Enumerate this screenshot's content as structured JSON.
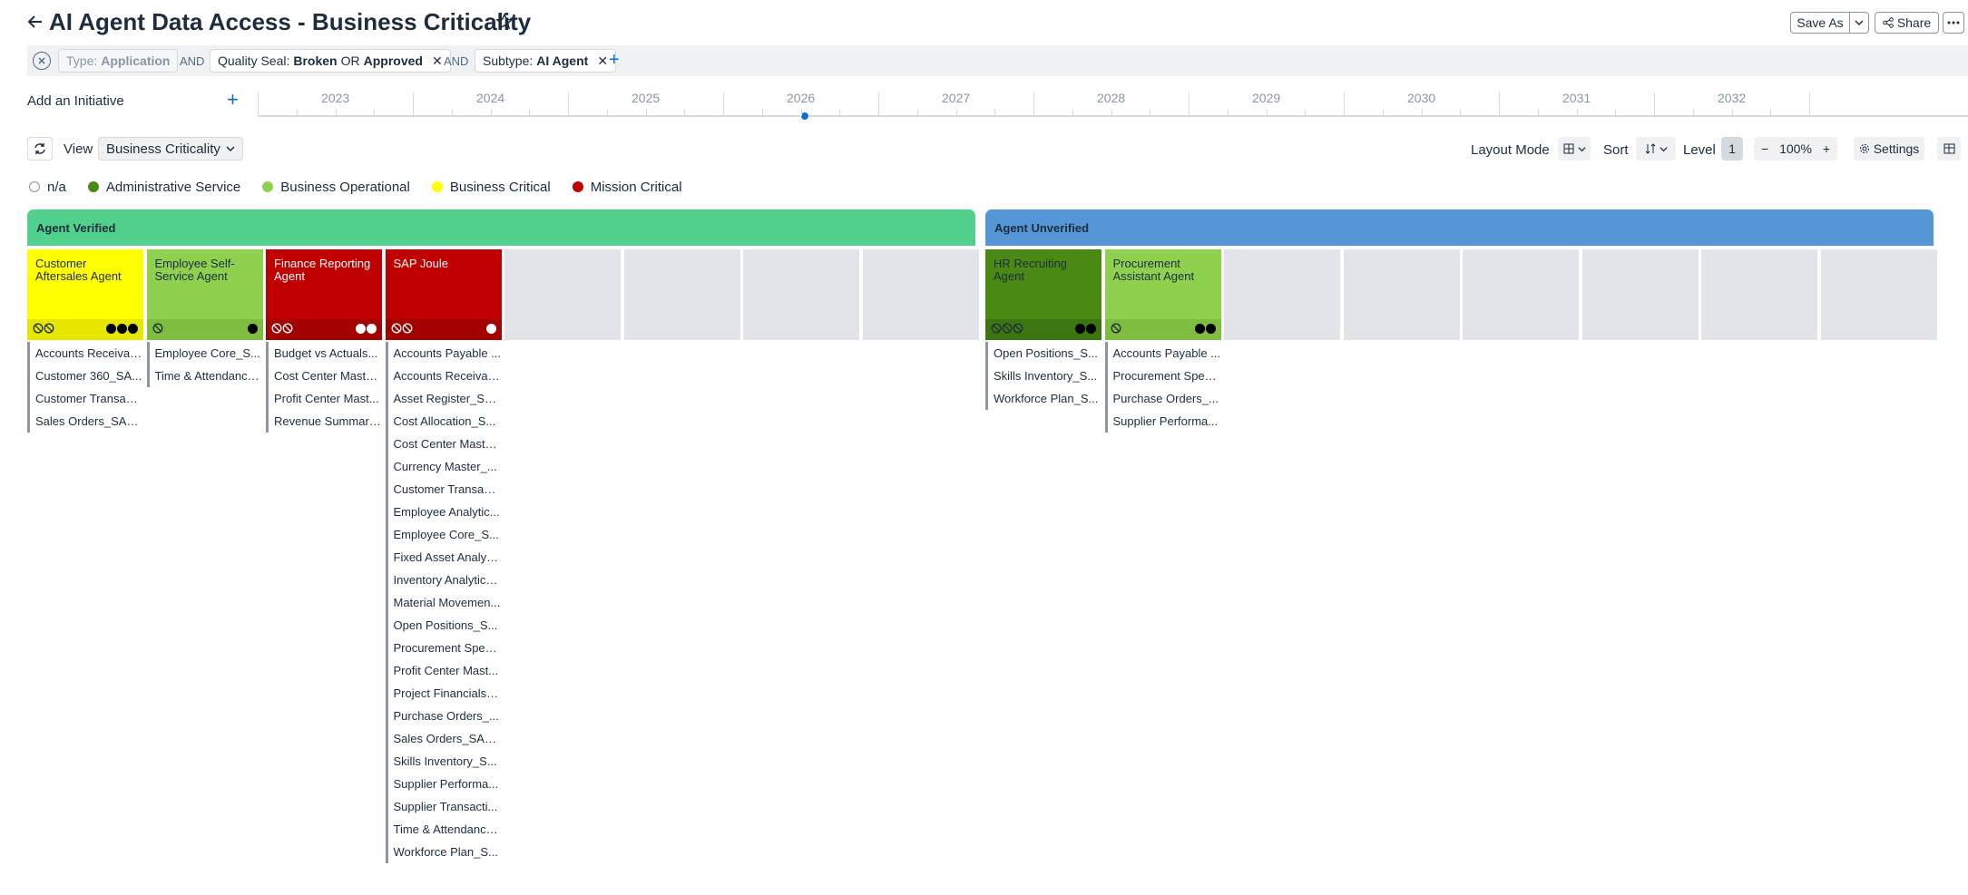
{
  "header": {
    "title": "AI Agent Data Access - Business Criticality",
    "save_as_label": "Save As",
    "share_label": "Share"
  },
  "filters": {
    "chip1": {
      "key": "Type:",
      "value": "Application"
    },
    "op1": "AND",
    "chip2": {
      "key": "Quality Seal:",
      "value_a": "Broken",
      "or": "OR",
      "value_b": "Approved"
    },
    "op2": "AND",
    "chip3": {
      "key": "Subtype:",
      "value": "AI Agent"
    }
  },
  "timeline": {
    "add_initiative_label": "Add an Initiative",
    "years": [
      "2023",
      "2024",
      "2025",
      "2026",
      "2027",
      "2028",
      "2029",
      "2030",
      "2031",
      "2032"
    ],
    "current_year": "2026"
  },
  "toolbar": {
    "view_label": "View",
    "view_value": "Business Criticality",
    "layout_mode_label": "Layout Mode",
    "sort_label": "Sort",
    "level_label": "Level",
    "level_value": "1",
    "zoom_value": "100%",
    "settings_label": "Settings"
  },
  "legend": [
    {
      "label": "n/a",
      "color": "#ffffff"
    },
    {
      "label": "Administrative Service",
      "color": "#4a8a14"
    },
    {
      "label": "Business Operational",
      "color": "#8fd14f"
    },
    {
      "label": "Business Critical",
      "color": "#ffff00"
    },
    {
      "label": "Mission Critical",
      "color": "#c00000"
    }
  ],
  "groups": [
    {
      "name": "Agent Verified",
      "color": "#52d18c",
      "agents": [
        {
          "title": "Customer Aftersales Agent",
          "criticality": "Business Critical",
          "seals": 2,
          "dots": [
            "#000",
            "#000",
            "#000"
          ],
          "items": [
            "Accounts Receivab...",
            "Customer 360_SA...",
            "Customer Transact...",
            "Sales Orders_SAP ..."
          ]
        },
        {
          "title": "Employee Self-Service Agent",
          "criticality": "Business Operational",
          "seals": 1,
          "dots": [
            "#000"
          ],
          "items": [
            "Employee Core_S...",
            "Time & Attendance..."
          ]
        },
        {
          "title": "Finance Reporting Agent",
          "criticality": "Mission Critical",
          "seals": 2,
          "dots": [
            "#fff",
            "#fff"
          ],
          "items": [
            "Budget vs Actuals...",
            "Cost Center Maste...",
            "Profit Center Mast...",
            "Revenue Summary..."
          ]
        },
        {
          "title": "SAP Joule",
          "criticality": "Mission Critical",
          "seals": 2,
          "dots": [
            "#fff"
          ],
          "items": [
            "Accounts Payable ...",
            "Accounts Receivab...",
            "Asset Register_SA...",
            "Cost Allocation_S...",
            "Cost Center Maste...",
            "Currency Master_...",
            "Customer Transact...",
            "Employee Analytic...",
            "Employee Core_S...",
            "Fixed Asset Analyti...",
            "Inventory Analytics...",
            "Material Movemen...",
            "Open Positions_S...",
            "Procurement Spen...",
            "Profit Center Mast...",
            "Project Financials_...",
            "Purchase Orders_...",
            "Sales Orders_SAP ...",
            "Skills Inventory_S...",
            "Supplier Performa...",
            "Supplier Transacti...",
            "Time & Attendance...",
            "Workforce Plan_S..."
          ]
        }
      ]
    },
    {
      "name": "Agent Unverified",
      "color": "#5496d6",
      "agents": [
        {
          "title": "HR Recruiting Agent",
          "criticality": "Administrative Service",
          "seals": 3,
          "dots": [
            "#000",
            "#000"
          ],
          "items": [
            "Open Positions_S...",
            "Skills Inventory_S...",
            "Workforce Plan_S..."
          ]
        },
        {
          "title": "Procurement Assistant Agent",
          "criticality": "Business Operational",
          "seals": 1,
          "dots": [
            "#000",
            "#000"
          ],
          "items": [
            "Accounts Payable ...",
            "Procurement Spen...",
            "Purchase Orders_...",
            "Supplier Performa..."
          ]
        }
      ]
    }
  ]
}
